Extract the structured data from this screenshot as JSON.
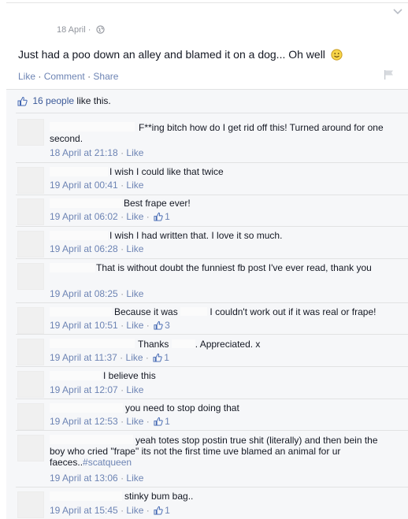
{
  "post": {
    "date": "18 April",
    "privacy_separator": "·",
    "text": "Just had a poo down an alley and blamed it on a dog... Oh well",
    "actions": {
      "like": "Like",
      "comment": "Comment",
      "share": "Share",
      "separator": "·"
    }
  },
  "likes": {
    "count_text": "16 people",
    "suffix": "like this."
  },
  "comments": [
    {
      "line1": "F**ing bitch how do I get rid off this! Turned around for one",
      "line2": "second.",
      "time": "18 April at 21:18",
      "like": "Like",
      "likes": ""
    },
    {
      "line1": "I wish I could like that twice",
      "time": "19 April at 00:41",
      "like": "Like",
      "likes": ""
    },
    {
      "line1": "Best frape ever!",
      "time": "19 April at 06:02",
      "like": "Like",
      "likes": "1"
    },
    {
      "line1": "I wish I had written that. I love it so much.",
      "time": "19 April at 06:28",
      "like": "Like",
      "likes": ""
    },
    {
      "line1": "That is without doubt the funniest fb post I've ever read, thank you",
      "time": "19 April at 08:25",
      "like": "Like",
      "likes": ""
    },
    {
      "line1a": "Because it was",
      "line1b": "I couldn't work out if it was real or frape!",
      "time": "19 April at 10:51",
      "like": "Like",
      "likes": "3"
    },
    {
      "line1a": "Thanks",
      "line1b": ". Appreciated. x",
      "time": "19 April at 11:37",
      "like": "Like",
      "likes": "1"
    },
    {
      "line1": "I believe this",
      "time": "19 April at 12:07",
      "like": "Like",
      "likes": ""
    },
    {
      "line1": "you need to stop doing that",
      "time": "19 April at 12:53",
      "like": "Like",
      "likes": "1"
    },
    {
      "line1": "yeah totes stop postin true shit (literally) and then bein the",
      "line2": "boy who cried \"frape\" its not the first time uve blamed an animal for ur",
      "line3": "faeces..",
      "hashtag": "#scatqueen",
      "time": "19 April at 13:06",
      "like": "Like",
      "likes": ""
    },
    {
      "line1": "stinky bum bag..",
      "time": "19 April at 15:45",
      "like": "Like",
      "likes": "1"
    }
  ],
  "icons": {
    "chevron": "chevron-down-icon",
    "globe": "globe-icon",
    "smiley": "smiley-icon",
    "flag": "flag-icon",
    "thumb": "thumbs-up-icon"
  },
  "colors": {
    "link": "#6d84b4",
    "link_dark": "#3b5998",
    "meta": "#90949c",
    "text": "#141823",
    "ufi_bg": "#f6f7f9"
  }
}
